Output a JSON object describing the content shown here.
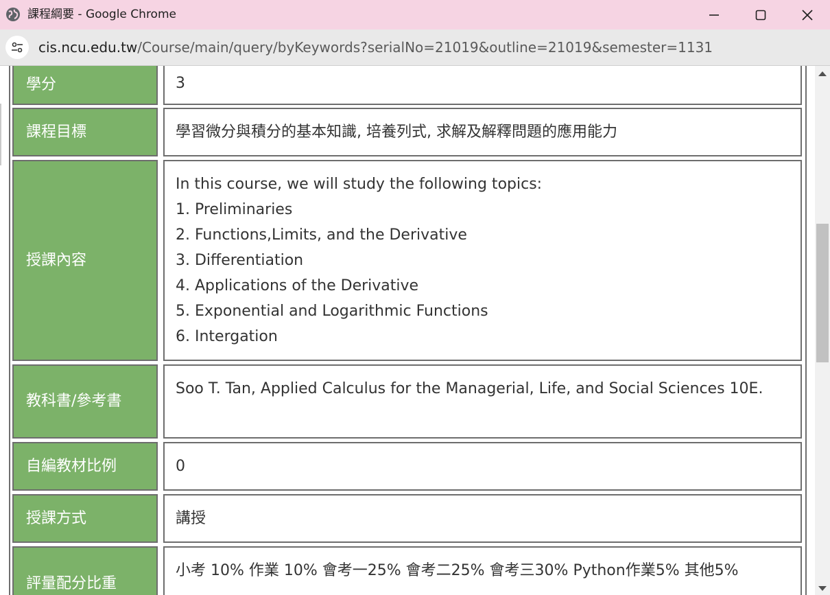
{
  "window": {
    "title": "課程綱要 - Google Chrome",
    "icons": {
      "tab": "globe-icon",
      "minimize": "minimize-icon",
      "maximize": "maximize-icon",
      "close": "close-icon"
    }
  },
  "addressbar": {
    "site_info_icon": "tune-icon",
    "url_host": "cis.ncu.edu.tw",
    "url_path": "/Course/main/query/byKeywords?serialNo=21019&outline=21019&semester=1131"
  },
  "colors": {
    "label_bg": "#7cb269",
    "border": "#6d6d6d",
    "titlebar": "#f6d4e3"
  },
  "outline": {
    "credits": {
      "label": "學分",
      "value": "3"
    },
    "objective": {
      "label": "課程目標",
      "value": "學習微分與積分的基本知識, 培養列式, 求解及解釋問題的應用能力"
    },
    "content": {
      "label": "授課內容",
      "lines": [
        "In this course, we will study the following topics:",
        "1. Preliminaries",
        "2. Functions,Limits, and the Derivative",
        "3. Differentiation",
        "4. Applications of the Derivative",
        "5. Exponential and Logarithmic Functions",
        "6. Intergation"
      ]
    },
    "textbook": {
      "label": "教科書/參考書",
      "value": "Soo T. Tan, Applied Calculus for the Managerial, Life, and Social Sciences 10E."
    },
    "self_material": {
      "label": "自編教材比例",
      "value": "0"
    },
    "teaching_method": {
      "label": "授課方式",
      "value": "講授"
    },
    "grading": {
      "label": "評量配分比重",
      "value": "小考 10% 作業 10% 會考一25% 會考二25% 會考三30% Python作業5% 其他5%"
    }
  }
}
